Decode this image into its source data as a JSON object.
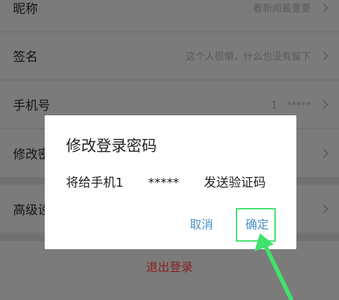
{
  "settings": {
    "rows": [
      {
        "label": "昵称",
        "value": "看新闻最重要"
      },
      {
        "label": "签名",
        "value": "这个人很懒，什么也没有留下"
      },
      {
        "label": "手机号",
        "value": "1　*****"
      },
      {
        "label": "修改密码",
        "value": ""
      },
      {
        "label": "高级设置",
        "value": ""
      }
    ],
    "logout_label": "退出登录"
  },
  "dialog": {
    "title": "修改登录密码",
    "message": "将给手机1　　*****　　发送验证码",
    "cancel_label": "取消",
    "confirm_label": "确定"
  },
  "colors": {
    "highlight": "#3fe36c",
    "button_text": "#4a8fc4",
    "logout_text": "#8a1f1f"
  }
}
